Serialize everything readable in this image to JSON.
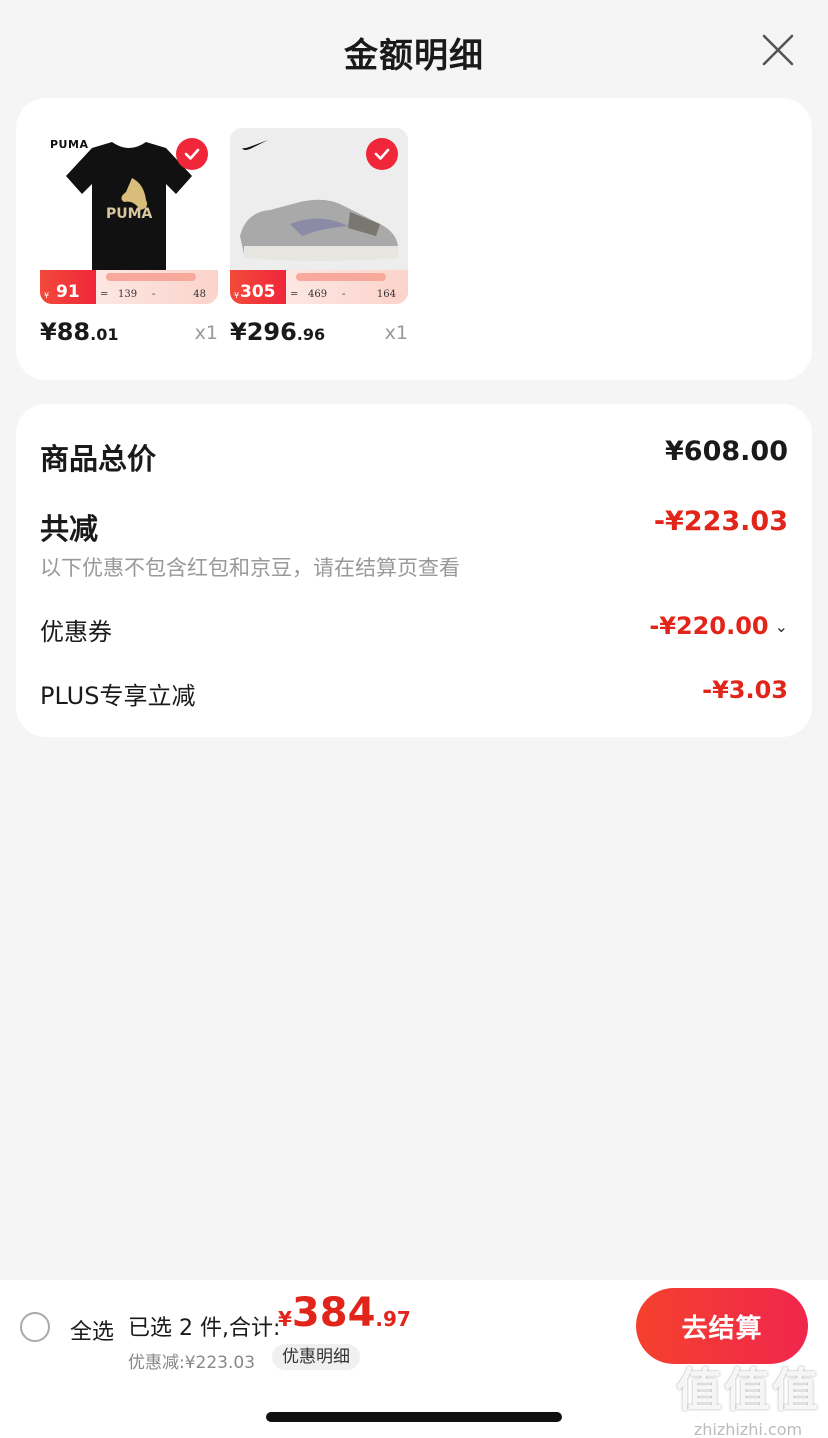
{
  "header": {
    "title": "金额明细"
  },
  "products": [
    {
      "brand": "PUMA",
      "promo_price": "91",
      "promo_yen": "¥",
      "promo_a": "139",
      "promo_minus": "-",
      "promo_b": "48",
      "promo_eq": "=",
      "price_int": "¥88",
      "price_dec": ".01",
      "qty": "x1"
    },
    {
      "brand": "✓",
      "promo_price": "305",
      "promo_yen": "¥",
      "promo_a": "469",
      "promo_minus": "-",
      "promo_b": "164",
      "promo_eq": "=",
      "price_int": "¥296",
      "price_dec": ".96",
      "qty": "x1"
    }
  ],
  "summary": {
    "total_label": "商品总价",
    "total_value": "¥608.00",
    "reduce_label": "共减",
    "reduce_value": "-¥223.03",
    "note": "以下优惠不包含红包和京豆，请在结算页查看",
    "coupon_label": "优惠券",
    "coupon_value": "-¥220.00",
    "plus_label": "PLUS专享立减",
    "plus_value": "-¥3.03"
  },
  "bottom": {
    "select_all": "全选",
    "selected": "已选 2 件,合计:",
    "total_yen": "¥",
    "total_int": "384",
    "total_dec": ".97",
    "discount": "优惠减:¥223.03",
    "detail": "优惠明细",
    "checkout": "去结算"
  },
  "watermark": {
    "big": "值值值",
    "small": "zhizhizhi.com"
  },
  "colors": {
    "accent": "#e1251b",
    "check": "#f0263a"
  }
}
